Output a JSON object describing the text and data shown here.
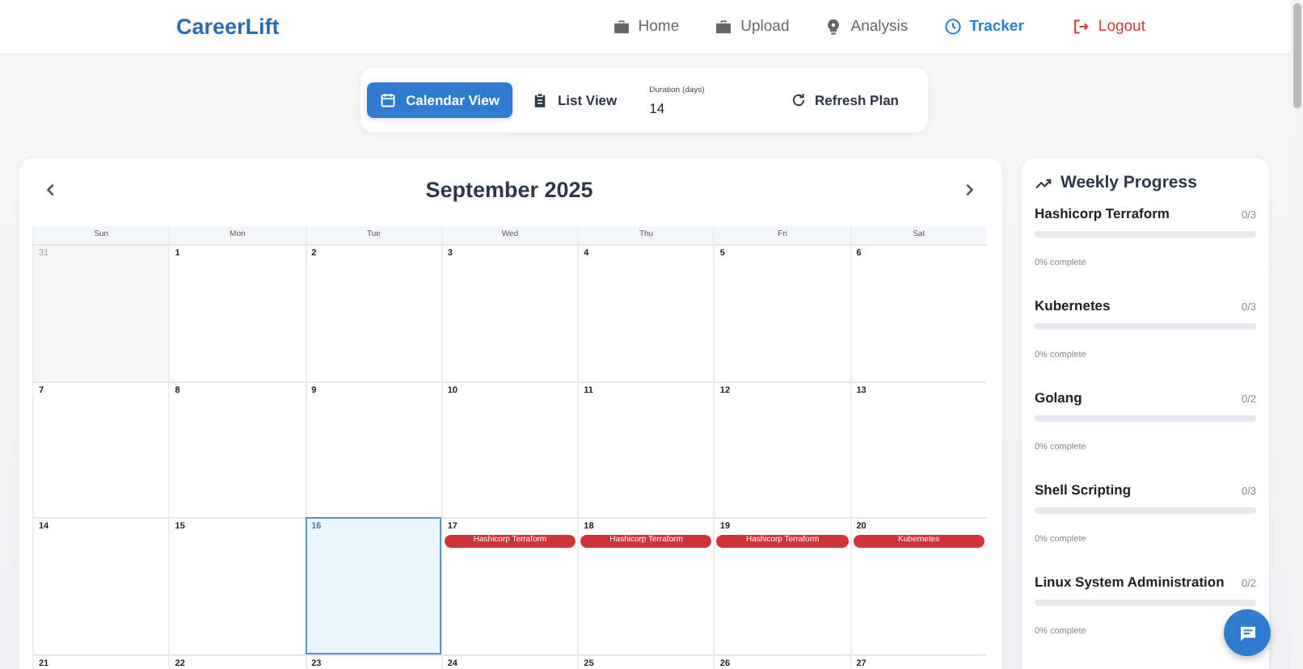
{
  "header": {
    "logo": "CareerLift",
    "nav": [
      {
        "kind": "briefcase",
        "label": "Home",
        "selected": false
      },
      {
        "kind": "briefcase",
        "label": "Upload",
        "selected": false
      },
      {
        "kind": "bulb",
        "label": "Analysis",
        "selected": false
      },
      {
        "kind": "clock",
        "label": "Tracker",
        "selected": true
      },
      {
        "kind": "logout",
        "label": "Logout",
        "selected": false
      }
    ]
  },
  "toolbar": {
    "views": [
      {
        "kind": "calendar",
        "label": "Calendar View",
        "selected": true
      },
      {
        "kind": "list",
        "label": "List View",
        "selected": false
      }
    ],
    "duration": {
      "label": "Duration (days)",
      "value": "14"
    },
    "refresh": "Refresh Plan"
  },
  "calendar": {
    "title": "September 2025",
    "weekdays": [
      "Sun",
      "Mon",
      "Tue",
      "Wed",
      "Thu",
      "Fri",
      "Sat"
    ],
    "weeks": [
      [
        {
          "day": "31",
          "outside": true,
          "today": false
        },
        {
          "day": "1",
          "outside": false,
          "today": false
        },
        {
          "day": "2",
          "outside": false,
          "today": false
        },
        {
          "day": "3",
          "outside": false,
          "today": false
        },
        {
          "day": "4",
          "outside": false,
          "today": false
        },
        {
          "day": "5",
          "outside": false,
          "today": false
        },
        {
          "day": "6",
          "outside": false,
          "today": false
        }
      ],
      [
        {
          "day": "7",
          "outside": false,
          "today": false
        },
        {
          "day": "8",
          "outside": false,
          "today": false
        },
        {
          "day": "9",
          "outside": false,
          "today": false
        },
        {
          "day": "10",
          "outside": false,
          "today": false
        },
        {
          "day": "11",
          "outside": false,
          "today": false
        },
        {
          "day": "12",
          "outside": false,
          "today": false
        },
        {
          "day": "13",
          "outside": false,
          "today": false
        }
      ],
      [
        {
          "day": "14",
          "outside": false,
          "today": false
        },
        {
          "day": "15",
          "outside": false,
          "today": false
        },
        {
          "day": "16",
          "outside": false,
          "today": true
        },
        {
          "day": "17",
          "outside": false,
          "today": false,
          "events": [
            "Hashicorp Terraform"
          ]
        },
        {
          "day": "18",
          "outside": false,
          "today": false,
          "events": [
            "Hashicorp Terraform"
          ]
        },
        {
          "day": "19",
          "outside": false,
          "today": false,
          "events": [
            "Hashicorp Terraform"
          ]
        },
        {
          "day": "20",
          "outside": false,
          "today": false,
          "events": [
            "Kubernetes"
          ]
        }
      ],
      [
        {
          "day": "21",
          "outside": false,
          "today": false
        },
        {
          "day": "22",
          "outside": false,
          "today": false
        },
        {
          "day": "23",
          "outside": false,
          "today": false
        },
        {
          "day": "24",
          "outside": false,
          "today": false
        },
        {
          "day": "25",
          "outside": false,
          "today": false
        },
        {
          "day": "26",
          "outside": false,
          "today": false
        },
        {
          "day": "27",
          "outside": false,
          "today": false
        }
      ]
    ]
  },
  "progress": {
    "title": "Weekly Progress",
    "items": [
      {
        "name": "Hashicorp Terraform",
        "count": "0/3",
        "level": 0,
        "caption": "0% complete"
      },
      {
        "name": "Kubernetes",
        "count": "0/3",
        "level": 0,
        "caption": "0% complete"
      },
      {
        "name": "Golang",
        "count": "0/2",
        "level": 0,
        "caption": "0% complete"
      },
      {
        "name": "Shell Scripting",
        "count": "0/3",
        "level": 0,
        "caption": "0% complete"
      },
      {
        "name": "Linux System Administration",
        "count": "0/2",
        "level": 0,
        "caption": "0% complete"
      }
    ]
  }
}
